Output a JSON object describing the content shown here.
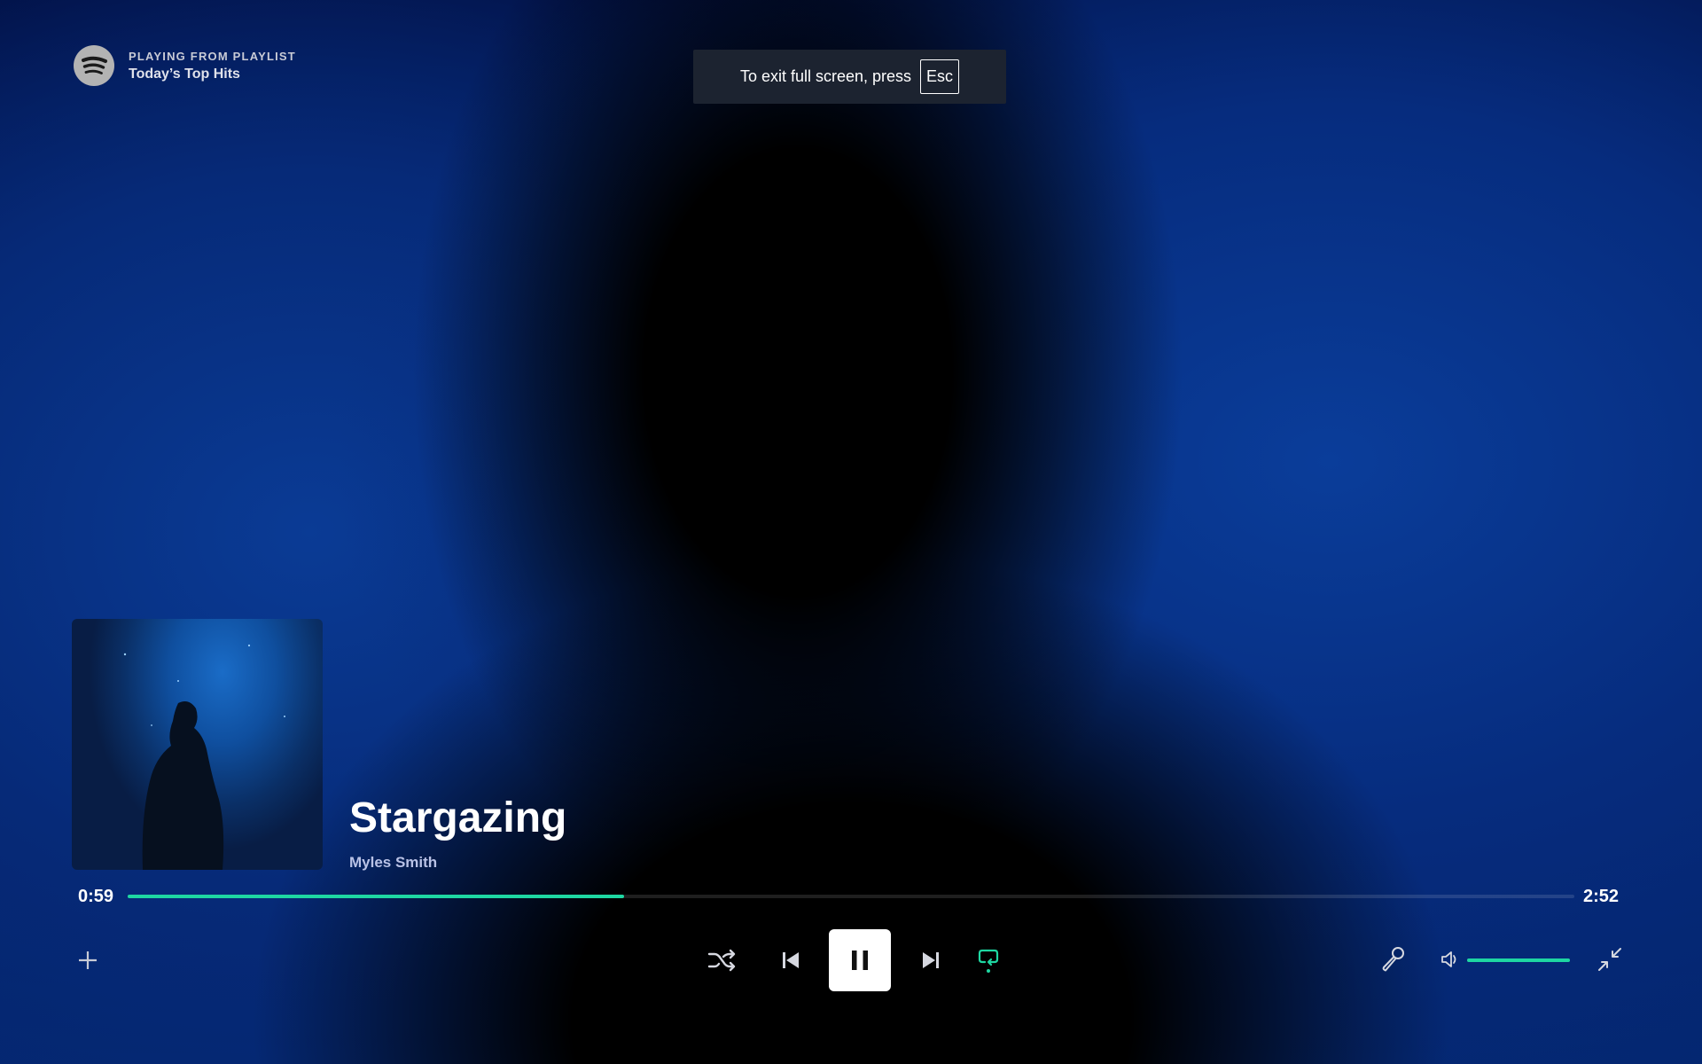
{
  "header": {
    "context_label": "PLAYING FROM PLAYLIST",
    "playlist_name": "Today’s Top Hits",
    "logo_icon": "spotify-logo-icon"
  },
  "fullscreen_notice": {
    "text": "To exit full screen, press",
    "key": "Esc"
  },
  "now_playing": {
    "title": "Stargazing",
    "artist": "Myles Smith",
    "cover_icon": "album-cover"
  },
  "playback": {
    "elapsed": "0:59",
    "total": "2:52",
    "progress_fraction": 0.343,
    "is_playing": true,
    "repeat_active": true
  },
  "volume": {
    "level_fraction": 1.0
  },
  "controls": {
    "add_icon": "plus-icon",
    "shuffle_icon": "shuffle-icon",
    "previous_icon": "skip-previous-icon",
    "pause_icon": "pause-icon",
    "next_icon": "skip-next-icon",
    "repeat_icon": "repeat-icon",
    "lyrics_icon": "microphone-icon",
    "volume_icon": "speaker-icon",
    "exit_fullscreen_icon": "minimize-icon"
  },
  "colors": {
    "accent": "#1ed7a2",
    "background": "#04266f",
    "toast": "#1c2330"
  }
}
